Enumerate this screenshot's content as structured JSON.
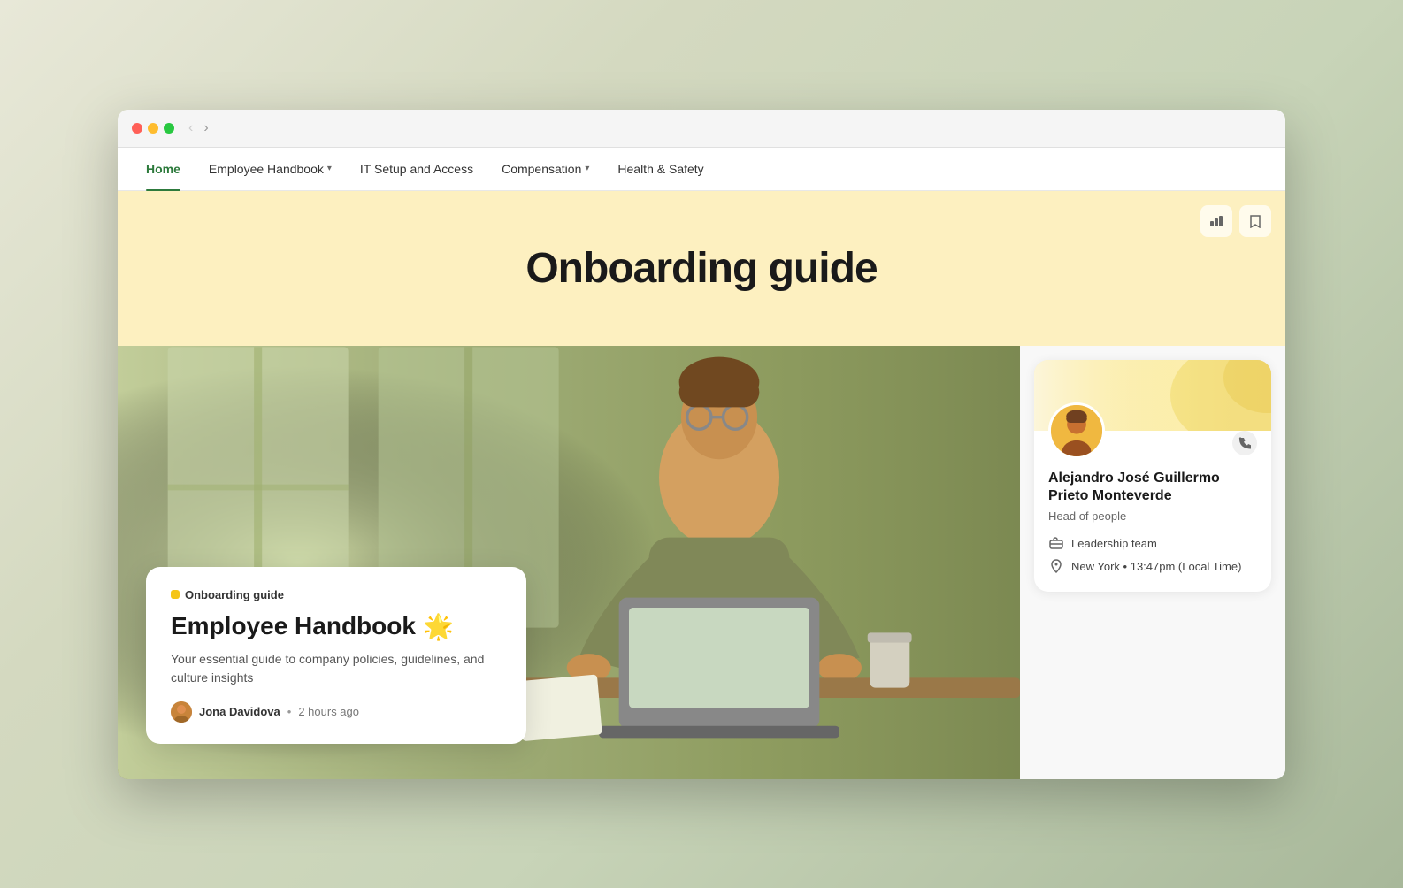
{
  "browser": {
    "nav_back_label": "‹",
    "nav_forward_label": "›"
  },
  "nav": {
    "items": [
      {
        "id": "home",
        "label": "Home",
        "active": true,
        "has_dropdown": false
      },
      {
        "id": "employee-handbook",
        "label": "Employee Handbook",
        "active": false,
        "has_dropdown": true
      },
      {
        "id": "it-setup",
        "label": "IT Setup and Access",
        "active": false,
        "has_dropdown": false
      },
      {
        "id": "compensation",
        "label": "Compensation",
        "active": false,
        "has_dropdown": true
      },
      {
        "id": "health-safety",
        "label": "Health & Safety",
        "active": false,
        "has_dropdown": false
      }
    ]
  },
  "hero": {
    "title": "Onboarding guide",
    "actions": [
      {
        "id": "chart",
        "icon": "▦",
        "label": "chart-icon"
      },
      {
        "id": "bookmark",
        "icon": "🔖",
        "label": "bookmark-icon"
      }
    ]
  },
  "card": {
    "breadcrumb": "Onboarding guide",
    "title": "Employee Handbook",
    "emoji": "🌟",
    "description": "Your essential guide to company policies, guidelines, and culture insights",
    "author_name": "Jona Davidova",
    "time_ago": "2 hours ago",
    "dot_separator": "•"
  },
  "sidebar": {
    "profile": {
      "name": "Alejandro José Guillermo Prieto Monteverde",
      "role": "Head of people",
      "team": "Leadership team",
      "location": "New York",
      "local_time": "13:47pm (Local Time)",
      "phone_icon": "📞"
    }
  },
  "icons": {
    "briefcase": "💼",
    "location": "📍"
  }
}
